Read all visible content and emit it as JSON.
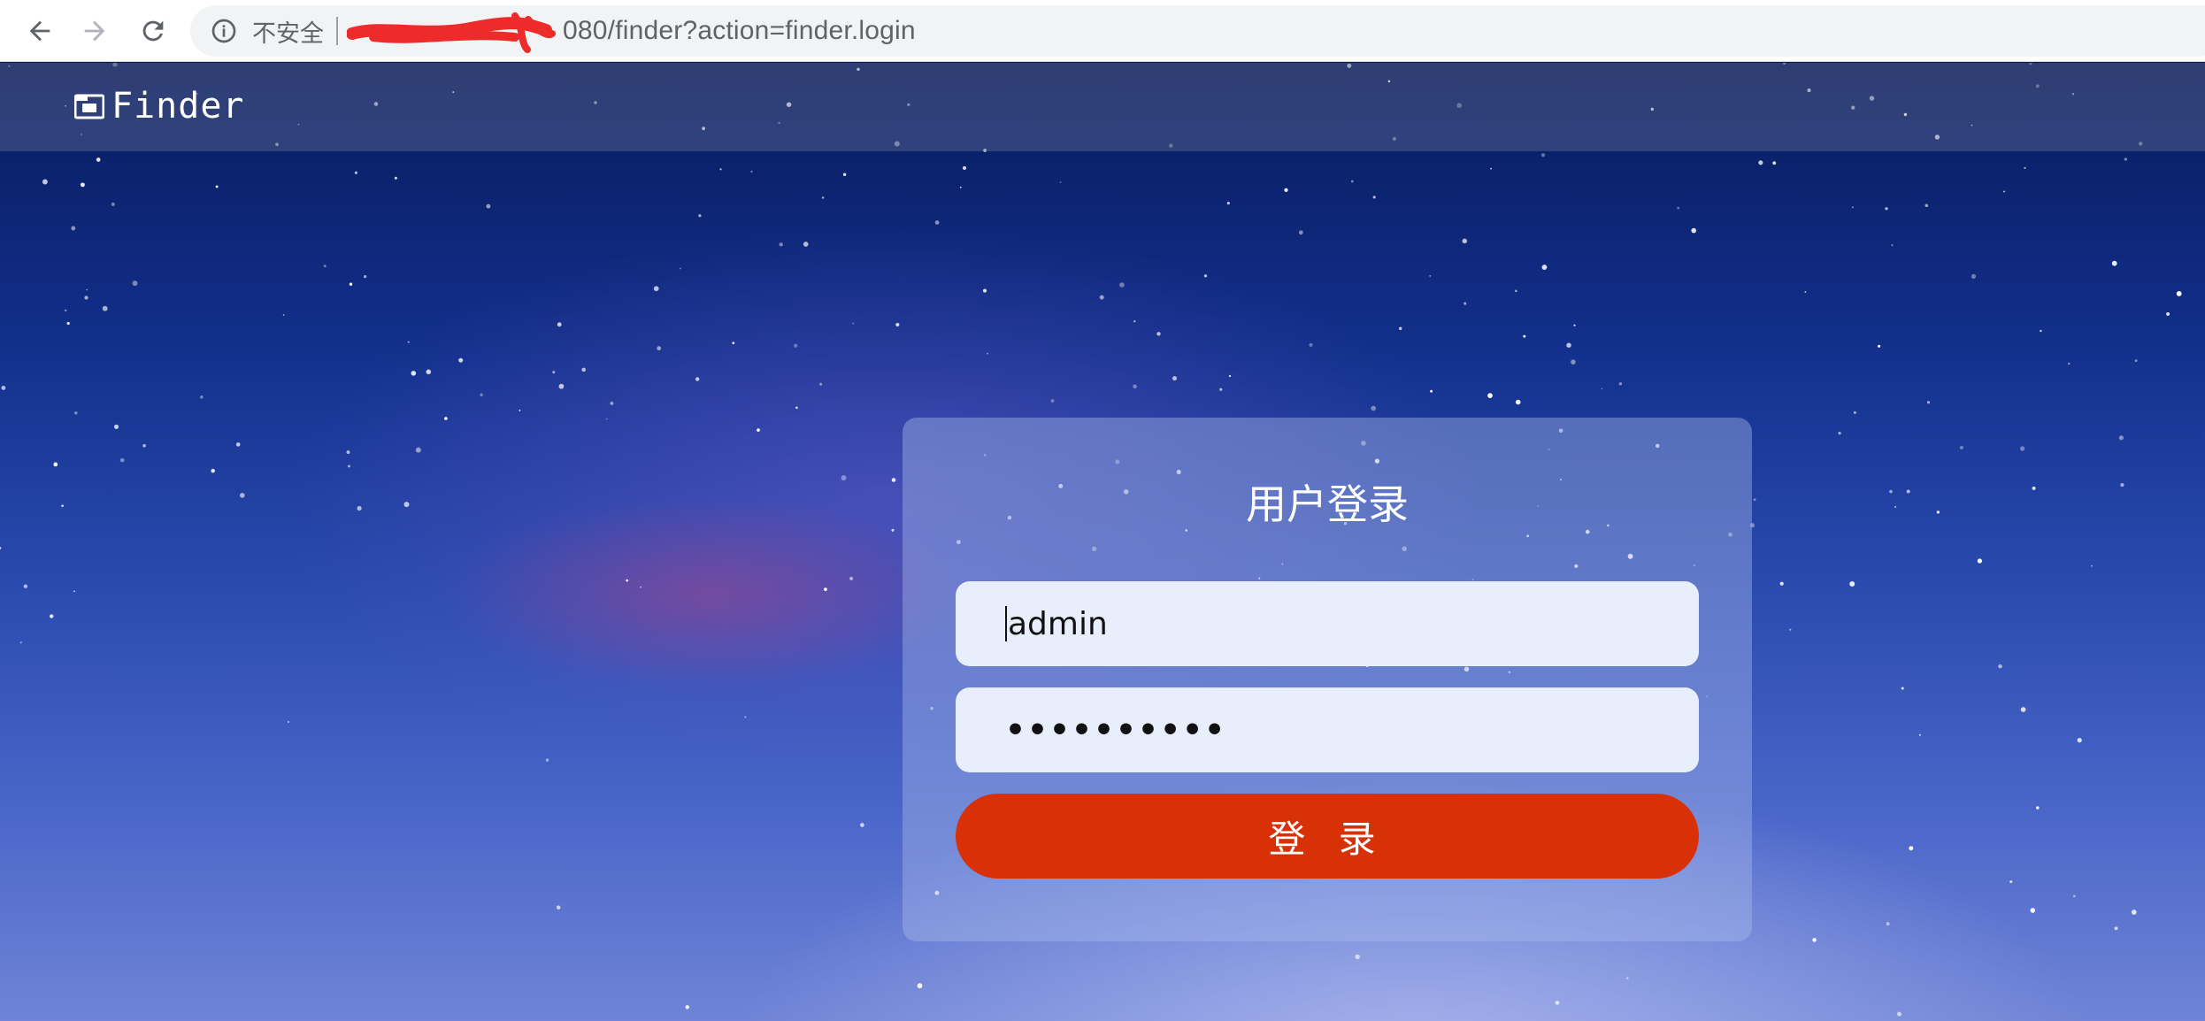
{
  "browser": {
    "security_label": "不安全",
    "url": "080/finder?action=finder.login"
  },
  "header": {
    "brand_name": "Finder"
  },
  "login": {
    "title": "用户登录",
    "username_value": "admin",
    "password_value": "••••••••••",
    "submit_label": "登 录"
  },
  "colors": {
    "button_bg": "#d93107",
    "field_bg": "#e8eefb"
  }
}
